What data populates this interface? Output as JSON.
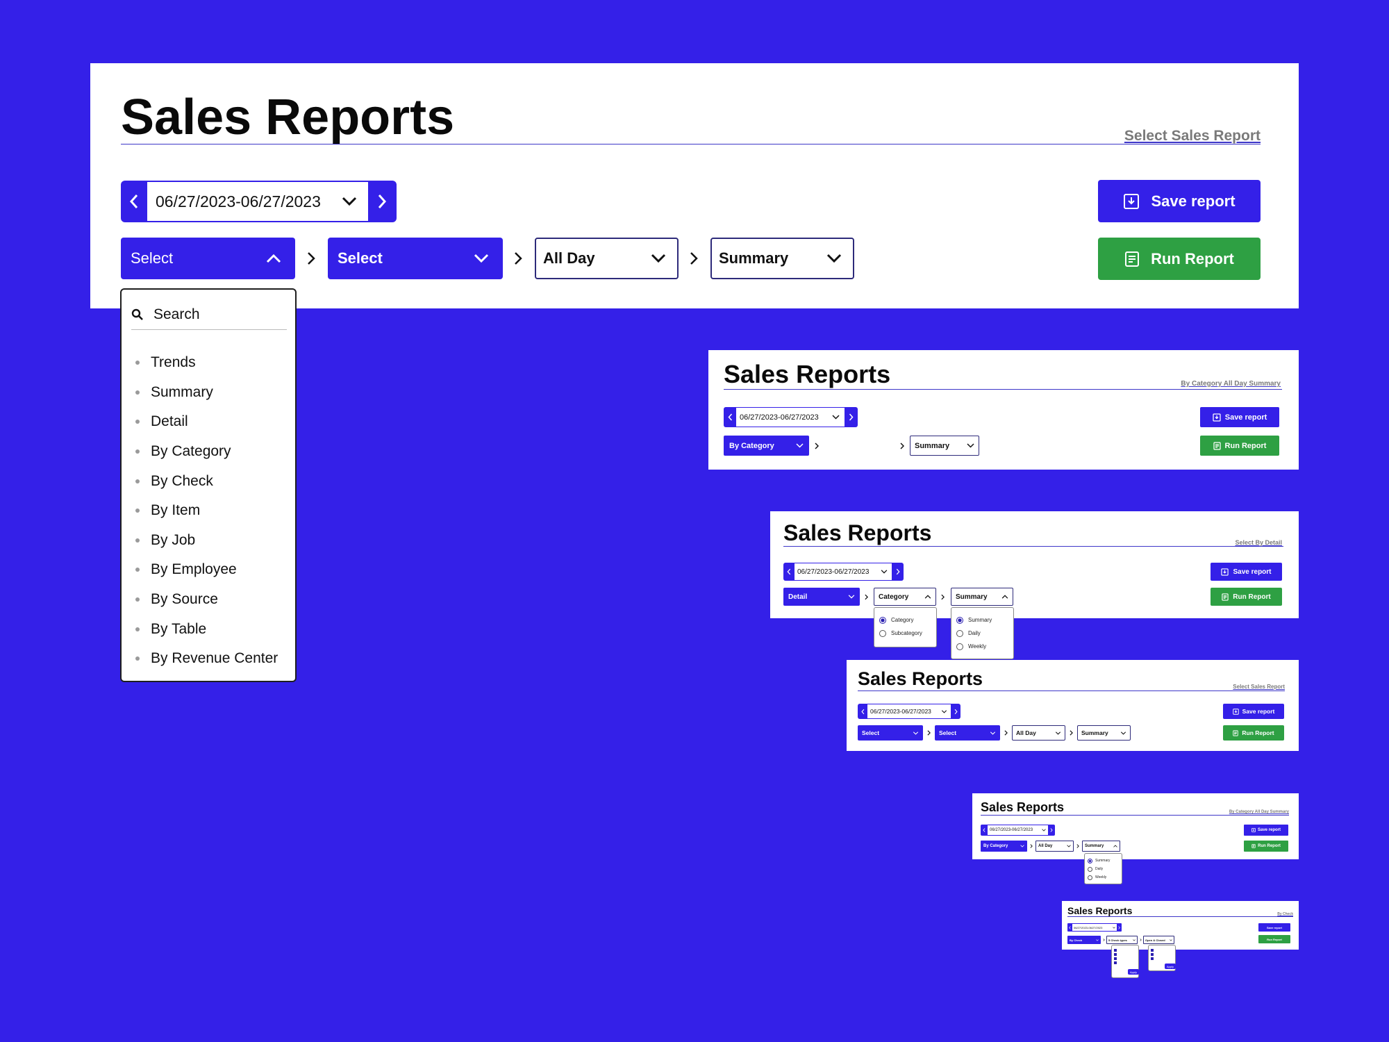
{
  "main": {
    "title": "Sales Reports",
    "subtitle": "Select Sales Report",
    "date_range": "06/27/2023-06/27/2023",
    "selects": [
      "Select",
      "Select",
      "All Day",
      "Summary"
    ],
    "save_label": "Save report",
    "run_label": "Run Report",
    "dropdown": {
      "search_placeholder": "Search",
      "items": [
        "Trends",
        "Summary",
        "Detail",
        "By Category",
        "By Check",
        "By Item",
        "By Job",
        "By Employee",
        "By Source",
        "By Table",
        "By Revenue Center"
      ]
    }
  },
  "mini1": {
    "title": "Sales Reports",
    "subtitle": "By Category All Day Summary",
    "date_range": "06/27/2023-06/27/2023",
    "selects": [
      "By Category",
      "Summary"
    ],
    "save_label": "Save report",
    "run_label": "Run Report"
  },
  "mini2": {
    "title": "Sales Reports",
    "subtitle": "Select By Detail",
    "date_range": "06/27/2023-06/27/2023",
    "selects": [
      "Detail",
      "Category",
      "Summary"
    ],
    "save_label": "Save report",
    "run_label": "Run Report",
    "pop_a": [
      "Category",
      "Subcategory"
    ],
    "pop_b": [
      "Summary",
      "Daily",
      "Weekly"
    ]
  },
  "mini3": {
    "title": "Sales Reports",
    "subtitle": "Select Sales Report",
    "date_range": "06/27/2023-06/27/2023",
    "selects": [
      "Select",
      "Select",
      "All Day",
      "Summary"
    ],
    "save_label": "Save report",
    "run_label": "Run Report"
  },
  "mini4": {
    "title": "Sales Reports",
    "subtitle": "By Category All Day Summary",
    "date_range": "06/27/2023-06/27/2023",
    "selects": [
      "By Category",
      "All Day",
      "Summary"
    ],
    "save_label": "Save report",
    "run_label": "Run Report",
    "pop": [
      "Summary",
      "Daily",
      "Weekly"
    ]
  },
  "mini5": {
    "title": "Sales Reports",
    "subtitle": "By Check",
    "date_range": "06/27/2023-06/27/2023",
    "selects": [
      "By Check",
      "5 Check types",
      "Open & Closed"
    ],
    "save_label": "Save report",
    "run_label": "Run Report",
    "apply_label": "Apply"
  },
  "colors": {
    "accent": "#3420e8",
    "green": "#2ea043",
    "background": "#3420e8"
  }
}
